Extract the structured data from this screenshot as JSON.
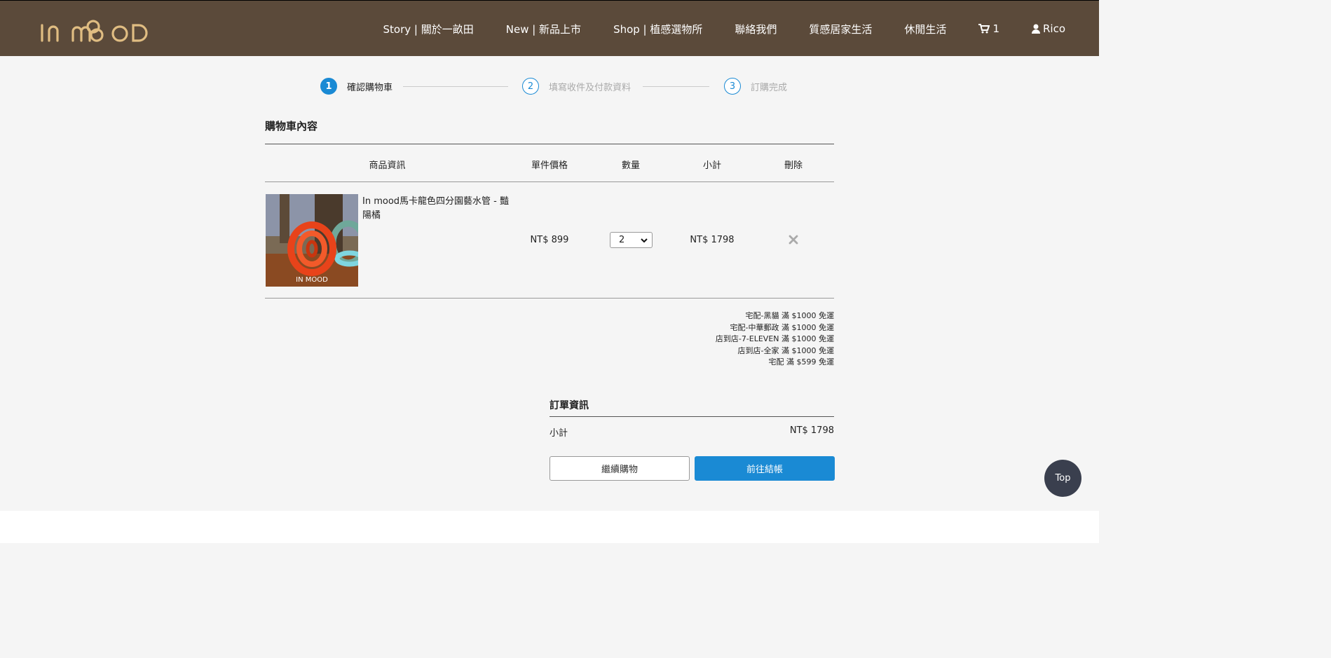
{
  "header": {
    "logo_text": "IN MOOD",
    "nav": [
      {
        "label": "Story | 關於一畝田"
      },
      {
        "label": "New | 新品上市"
      },
      {
        "label": "Shop | 植感選物所"
      },
      {
        "label": "聯絡我們"
      },
      {
        "label": "質感居家生活"
      },
      {
        "label": "休閒生活"
      }
    ],
    "cart_count": "1",
    "user_name": "Rico",
    "cart_icon": "cart-icon",
    "user_icon": "user-icon"
  },
  "steps": [
    {
      "number": "1",
      "label": "確認購物車",
      "active": true
    },
    {
      "number": "2",
      "label": "填寫收件及付款資料",
      "active": false
    },
    {
      "number": "3",
      "label": "訂購完成",
      "active": false
    }
  ],
  "cart": {
    "title": "購物車內容",
    "columns": [
      "商品資訊",
      "單件價格",
      "數量",
      "小計",
      "刪除"
    ],
    "items": [
      {
        "name": "In mood馬卡龍色四分園藝水管 - 豔陽橘",
        "price": "NT$ 899",
        "quantity": "2",
        "subtotal": "NT$ 1798",
        "image_watermark": "IN MOOD"
      }
    ]
  },
  "shipping_notes": [
    "宅配-黑貓 滿 $1000 免運",
    "宅配-中華郵政 滿 $1000 免運",
    "店到店-7-ELEVEN 滿 $1000 免運",
    "店到店-全家 滿 $1000 免運",
    "宅配 滿 $599 免運"
  ],
  "order": {
    "title": "訂單資訊",
    "subtotal_label": "小計",
    "subtotal_value": "NT$ 1798",
    "continue_label": "繼續購物",
    "checkout_label": "前往結帳"
  },
  "top_button": "Top",
  "colors": {
    "header_bg": "#5b4a3a",
    "logo": "#e0bd82",
    "accent": "#1a8ad4"
  }
}
